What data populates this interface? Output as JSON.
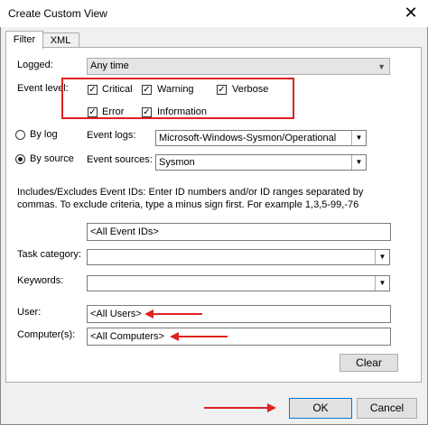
{
  "window": {
    "title": "Create Custom View",
    "close_glyph": "✕"
  },
  "tabs": [
    {
      "label": "Filter",
      "active": true
    },
    {
      "label": "XML",
      "active": false
    }
  ],
  "filter": {
    "logged": {
      "label": "Logged:",
      "value": "Any time"
    },
    "event_level": {
      "label": "Event level:",
      "levels": [
        {
          "label": "Critical",
          "checked": true
        },
        {
          "label": "Warning",
          "checked": true
        },
        {
          "label": "Verbose",
          "checked": true
        },
        {
          "label": "Error",
          "checked": true
        },
        {
          "label": "Information",
          "checked": true
        }
      ]
    },
    "by_log": {
      "label": "By log",
      "selected": false
    },
    "by_source": {
      "label": "By source",
      "selected": true
    },
    "event_logs": {
      "label": "Event logs:",
      "value": "Microsoft-Windows-Sysmon/Operational"
    },
    "event_sources": {
      "label": "Event sources:",
      "value": "Sysmon"
    },
    "event_ids_help": "Includes/Excludes Event IDs: Enter ID numbers and/or ID ranges separated by commas. To exclude criteria, type a minus sign first. For example 1,3,5-99,-76",
    "event_ids": {
      "value": "<All Event IDs>"
    },
    "task_category": {
      "label": "Task category:",
      "value": ""
    },
    "keywords": {
      "label": "Keywords:",
      "value": ""
    },
    "user": {
      "label": "User:",
      "value": "<All Users>"
    },
    "computers": {
      "label": "Computer(s):",
      "value": "<All Computers>"
    },
    "clear_label": "Clear"
  },
  "footer": {
    "ok_label": "OK",
    "cancel_label": "Cancel"
  },
  "colors": {
    "highlight": "#e02020",
    "ok_border": "#0078d7"
  }
}
